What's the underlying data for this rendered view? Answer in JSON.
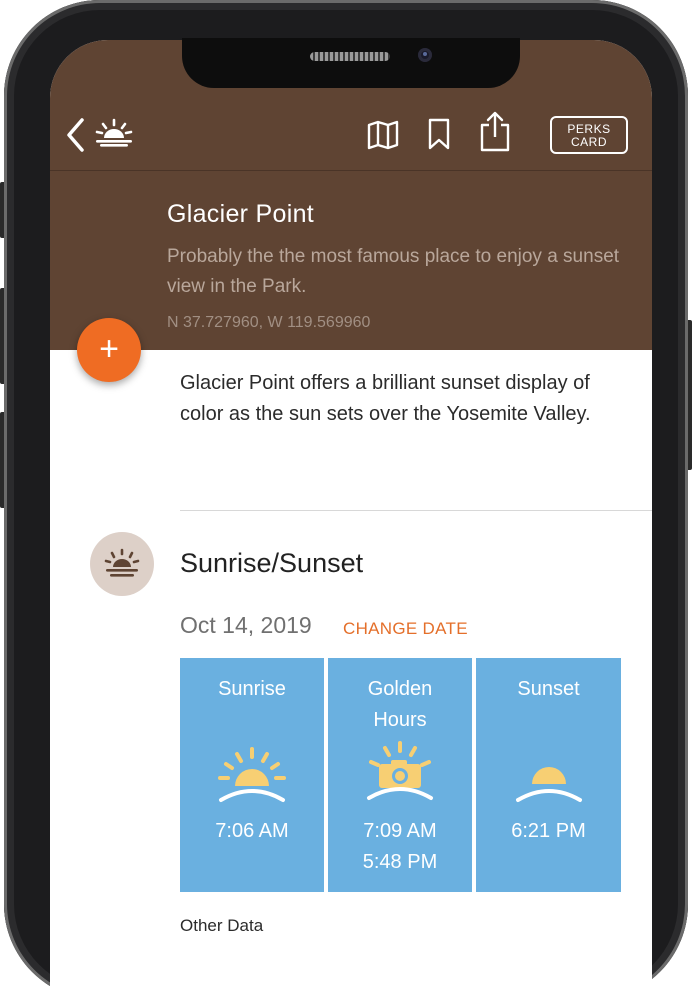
{
  "nav": {
    "back_icon": "chevron-left-icon",
    "logo_icon": "sunrise-logo-icon",
    "map_icon": "map-icon",
    "bookmark_icon": "bookmark-icon",
    "share_icon": "share-icon",
    "perks_line1": "PERKS",
    "perks_line2": "CARD"
  },
  "place": {
    "title": "Glacier Point",
    "subtitle": "Probably the the most famous place to enjoy a sunset view in the Park.",
    "coords": "N 37.727960, W 119.569960"
  },
  "fab": {
    "label": "+"
  },
  "description": "Glacier Point offers a brilliant sunset display of color as the sun sets over the Yosemite Valley.",
  "sun": {
    "section_title": "Sunrise/Sunset",
    "date": "Oct 14, 2019",
    "change_date": "CHANGE DATE",
    "tiles": [
      {
        "label": "Sunrise",
        "times": [
          "7:06 AM"
        ]
      },
      {
        "label": "Golden Hours",
        "label_line1": "Golden",
        "label_line2": "Hours",
        "times": [
          "7:09 AM",
          "5:48 PM"
        ]
      },
      {
        "label": "Sunset",
        "times": [
          "6:21 PM"
        ]
      }
    ]
  },
  "other_data": "Other Data",
  "colors": {
    "header_bg": "#5f4433",
    "accent_orange": "#ef6c23",
    "tile_blue": "#6ab0e0",
    "sun_yellow": "#f7cf73"
  }
}
